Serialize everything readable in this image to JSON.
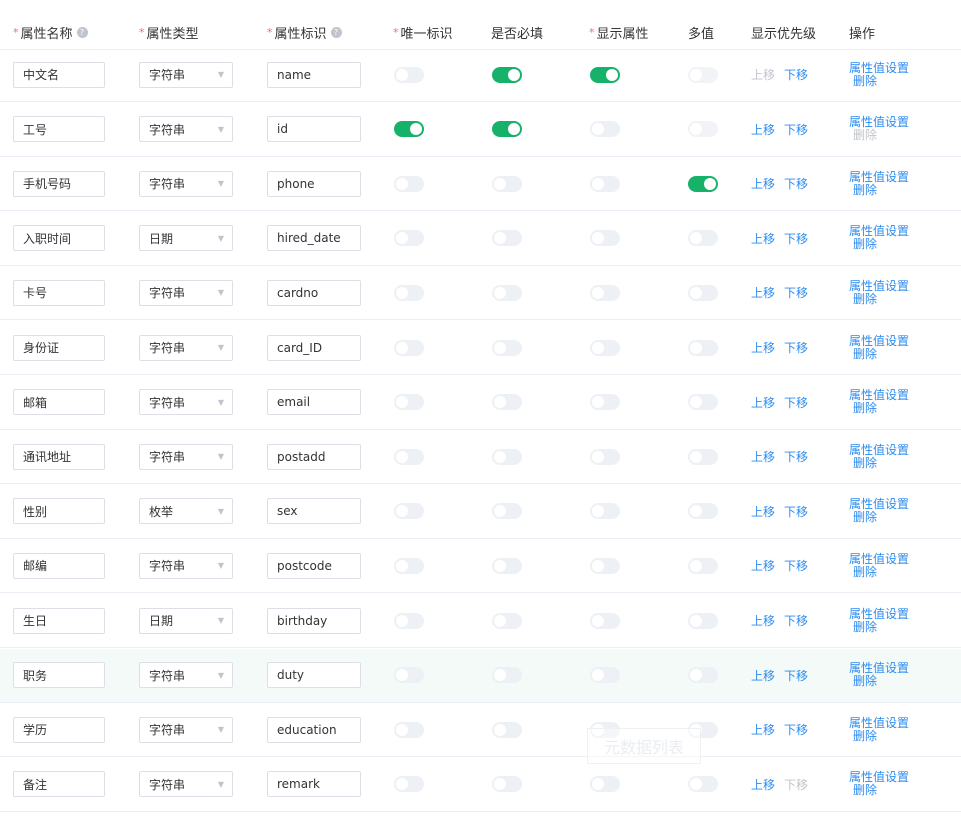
{
  "header": {
    "attr_name": "属性名称",
    "attr_type": "属性类型",
    "attr_key": "属性标识",
    "unique": "唯一标识",
    "required": "是否必填",
    "display": "显示属性",
    "multi": "多值",
    "priority": "显示优先级",
    "ops": "操作",
    "required_mark": "*",
    "help_mark": "?"
  },
  "labels": {
    "move_up": "上移",
    "move_down": "下移",
    "value_settings": "属性值设置",
    "delete": "删除"
  },
  "rows": [
    {
      "name": "中文名",
      "type": "字符串",
      "key": "name",
      "unique": false,
      "unique_disabled": false,
      "required": true,
      "required_disabled": false,
      "display": true,
      "display_disabled": false,
      "multi": false,
      "multi_disabled": true,
      "up_enabled": false,
      "down_enabled": true,
      "delete_enabled": true
    },
    {
      "name": "工号",
      "type": "字符串",
      "key": "id",
      "unique": true,
      "unique_disabled": false,
      "required": true,
      "required_disabled": false,
      "display": false,
      "display_disabled": false,
      "multi": false,
      "multi_disabled": true,
      "up_enabled": true,
      "down_enabled": true,
      "delete_enabled": false
    },
    {
      "name": "手机号码",
      "type": "字符串",
      "key": "phone",
      "unique": false,
      "unique_disabled": false,
      "required": false,
      "required_disabled": false,
      "display": false,
      "display_disabled": false,
      "multi": true,
      "multi_disabled": false,
      "up_enabled": true,
      "down_enabled": true,
      "delete_enabled": true
    },
    {
      "name": "入职时间",
      "type": "日期",
      "key": "hired_date",
      "unique": false,
      "unique_disabled": false,
      "required": false,
      "required_disabled": false,
      "display": false,
      "display_disabled": false,
      "multi": false,
      "multi_disabled": false,
      "up_enabled": true,
      "down_enabled": true,
      "delete_enabled": true
    },
    {
      "name": "卡号",
      "type": "字符串",
      "key": "cardno",
      "unique": false,
      "unique_disabled": false,
      "required": false,
      "required_disabled": false,
      "display": false,
      "display_disabled": false,
      "multi": false,
      "multi_disabled": false,
      "up_enabled": true,
      "down_enabled": true,
      "delete_enabled": true
    },
    {
      "name": "身份证",
      "type": "字符串",
      "key": "card_ID",
      "unique": false,
      "unique_disabled": false,
      "required": false,
      "required_disabled": false,
      "display": false,
      "display_disabled": false,
      "multi": false,
      "multi_disabled": false,
      "up_enabled": true,
      "down_enabled": true,
      "delete_enabled": true
    },
    {
      "name": "邮箱",
      "type": "字符串",
      "key": "email",
      "unique": false,
      "unique_disabled": false,
      "required": false,
      "required_disabled": false,
      "display": false,
      "display_disabled": false,
      "multi": false,
      "multi_disabled": false,
      "up_enabled": true,
      "down_enabled": true,
      "delete_enabled": true
    },
    {
      "name": "通讯地址",
      "type": "字符串",
      "key": "postadd",
      "unique": false,
      "unique_disabled": false,
      "required": false,
      "required_disabled": false,
      "display": false,
      "display_disabled": false,
      "multi": false,
      "multi_disabled": false,
      "up_enabled": true,
      "down_enabled": true,
      "delete_enabled": true
    },
    {
      "name": "性别",
      "type": "枚举",
      "key": "sex",
      "unique": false,
      "unique_disabled": false,
      "required": false,
      "required_disabled": false,
      "display": false,
      "display_disabled": false,
      "multi": false,
      "multi_disabled": false,
      "up_enabled": true,
      "down_enabled": true,
      "delete_enabled": true
    },
    {
      "name": "邮编",
      "type": "字符串",
      "key": "postcode",
      "unique": false,
      "unique_disabled": false,
      "required": false,
      "required_disabled": false,
      "display": false,
      "display_disabled": false,
      "multi": false,
      "multi_disabled": false,
      "up_enabled": true,
      "down_enabled": true,
      "delete_enabled": true
    },
    {
      "name": "生日",
      "type": "日期",
      "key": "birthday",
      "unique": false,
      "unique_disabled": false,
      "required": false,
      "required_disabled": false,
      "display": false,
      "display_disabled": false,
      "multi": false,
      "multi_disabled": false,
      "up_enabled": true,
      "down_enabled": true,
      "delete_enabled": true
    },
    {
      "name": "职务",
      "type": "字符串",
      "key": "duty",
      "unique": false,
      "unique_disabled": false,
      "required": false,
      "required_disabled": false,
      "display": false,
      "display_disabled": false,
      "multi": false,
      "multi_disabled": false,
      "up_enabled": true,
      "down_enabled": true,
      "delete_enabled": true,
      "highlighted": true
    },
    {
      "name": "学历",
      "type": "字符串",
      "key": "education",
      "unique": false,
      "unique_disabled": false,
      "required": false,
      "required_disabled": false,
      "display": false,
      "display_disabled": false,
      "multi": false,
      "multi_disabled": false,
      "up_enabled": true,
      "down_enabled": true,
      "delete_enabled": true
    },
    {
      "name": "备注",
      "type": "字符串",
      "key": "remark",
      "unique": false,
      "unique_disabled": false,
      "required": false,
      "required_disabled": false,
      "display": false,
      "display_disabled": false,
      "multi": false,
      "multi_disabled": false,
      "up_enabled": true,
      "down_enabled": false,
      "delete_enabled": true
    }
  ],
  "watermark": "元数据列表",
  "colors": {
    "switch_on": "#17b26a",
    "switch_off": "#edf0f5",
    "link": "#2d8cf0",
    "link_disabled": "#c0c4cc",
    "required_mark": "#f56c6c",
    "row_highlight": "#f3faf7"
  }
}
